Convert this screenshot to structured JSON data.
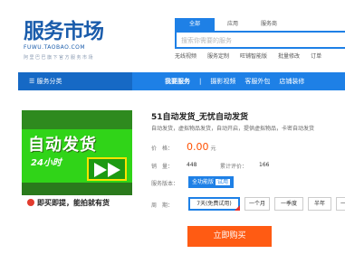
{
  "logo": {
    "cn": "服务市场",
    "en": "FUWU.TAOBAO.COM",
    "slogan": "阿里巴巴旗下官方服务市场"
  },
  "search": {
    "tabs": [
      "全部",
      "应用",
      "服务商"
    ],
    "placeholder": "搜索你需要的服务",
    "hotlinks": [
      "无线视频",
      "服务定制",
      "旺铺智能版",
      "批量修改",
      "订单"
    ]
  },
  "nav": {
    "category_label": "服务分类",
    "links": [
      "我要服务",
      "摄影视频",
      "客服外包",
      "店铺装修"
    ]
  },
  "product_image": {
    "title": "自动发货",
    "hours": "24小时",
    "slogan": "即买即提，能拍就有货"
  },
  "product": {
    "title": "51自动发货_无忧自动发货",
    "desc": "自动发货，虚拟物品发货，自动开启，提供虚拟物品，卡密自动发货",
    "price_label": "价　格：",
    "price": "0.00",
    "price_unit": "元",
    "sales_label": "销　量：",
    "sales": "448",
    "reviews_label": "累计评价：",
    "reviews": "166",
    "version_label": "服务版本：",
    "version": "全功能版",
    "version_tag": "试用",
    "period_label": "周　期：",
    "periods": [
      "7天(免费试用)",
      "一个月",
      "一季度",
      "半年",
      "一年"
    ],
    "buy": "立即购买"
  }
}
